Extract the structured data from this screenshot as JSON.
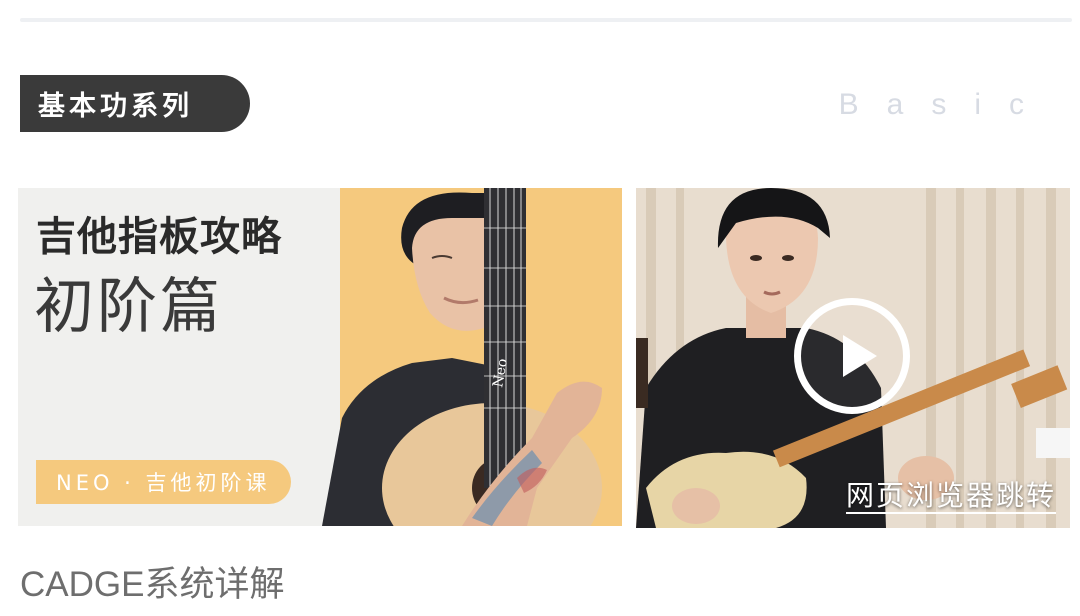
{
  "section": {
    "title": "基本功系列",
    "title_en": "Basic"
  },
  "cards": [
    {
      "title": "吉他指板攻略",
      "subtitle": "初阶篇",
      "tag": "NEO · 吉他初阶课",
      "neck_brand": "Neo"
    },
    {
      "link_label": "网页浏览器跳转",
      "play_icon": "play-icon"
    }
  ],
  "caption": "CADGE系统详解",
  "colors": {
    "pill_bg": "#3a3a3a",
    "accent_yellow": "#f5c97e",
    "title_en": "#d7dbe3"
  }
}
